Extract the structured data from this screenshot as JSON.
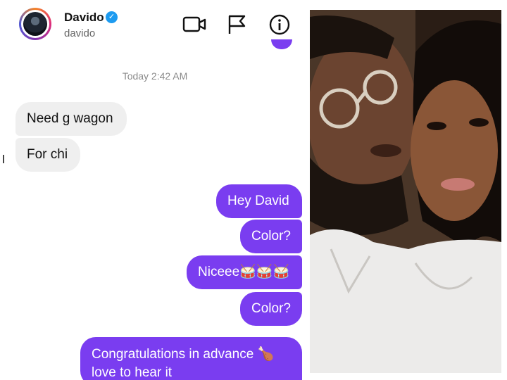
{
  "header": {
    "name": "Davido",
    "handle": "davido",
    "verified_mark": "✓",
    "icons": [
      "video-call-icon",
      "flag-icon",
      "info-icon"
    ]
  },
  "conversation": {
    "timestamp": "Today 2:42 AM",
    "messages": [
      {
        "side": "incoming",
        "text": "Need g wagon"
      },
      {
        "side": "incoming",
        "text": "For chi"
      },
      {
        "side": "outgoing",
        "text": "Hey David"
      },
      {
        "side": "outgoing",
        "text": "Color?"
      },
      {
        "side": "outgoing",
        "text": "Niceee🥁🥁🥁"
      },
      {
        "side": "outgoing",
        "text": "Color?"
      },
      {
        "side": "outgoing",
        "text": "Congratulations in advance 🍗 love to hear it"
      }
    ]
  },
  "colors": {
    "outgoing_bubble": "#7a3df0",
    "incoming_bubble": "#efefef",
    "verified": "#1d9bf0"
  }
}
